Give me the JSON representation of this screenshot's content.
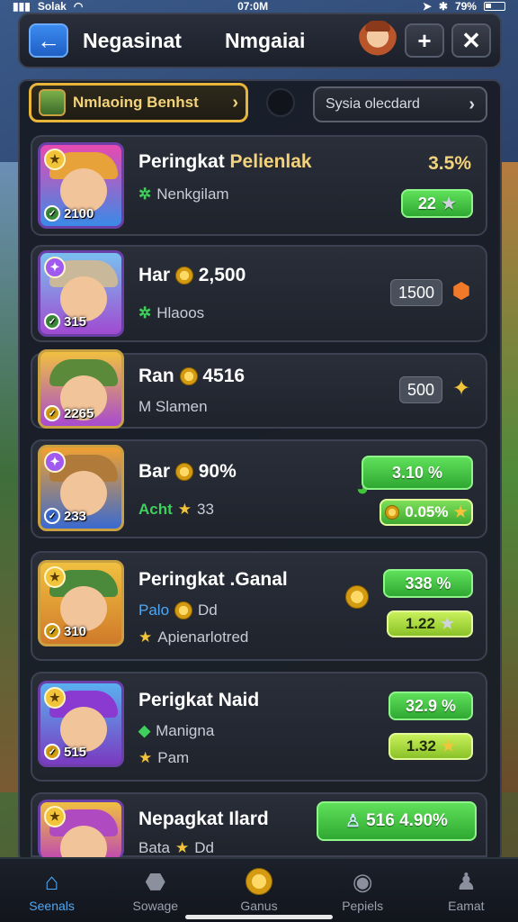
{
  "status": {
    "carrier": "Solak",
    "time": "07:0M",
    "battery": "79%"
  },
  "header": {
    "back_icon": "arrow-left-icon",
    "title": "Negasinat",
    "subtitle": "Nmgaiai",
    "plus_label": "+",
    "close_label": "✕"
  },
  "tabs": {
    "active_label": "Nmlaoing Benhst",
    "inactive_label": "Sysia olecdard"
  },
  "cards": [
    {
      "title": "Peringkat ",
      "title_accent": "Pelienlak",
      "sub": "Nenkgilam",
      "level": "2100",
      "pct": "3.5%",
      "pill": "22"
    },
    {
      "title": "Har",
      "title_value": "2,500",
      "sub": "Hlaoos",
      "level": "315",
      "pill": "1500"
    },
    {
      "title": "Ran",
      "title_value": "4516",
      "sub": "M Slamen",
      "level": "2265",
      "pill": "500"
    },
    {
      "title": "Bar",
      "title_value": "90%",
      "sub_label": "Acht",
      "sub": "33",
      "level": "233",
      "pill": "3.10 %",
      "pill2": "0.05%"
    },
    {
      "title": "Peringkat .Ganal",
      "sub_label": "Palo",
      "sub": "Dd",
      "sub2": "Apienarlotred",
      "level": "310",
      "pill": "338 %",
      "pill2": "1.22"
    },
    {
      "title": "Perigkat Naid",
      "sub": "Manigna",
      "sub2": "Pam",
      "level": "515",
      "pill": "32.9 %",
      "pill2": "1.32"
    },
    {
      "title": "Nepagkat Ilard",
      "sub_label": "Bata",
      "sub": "Dd",
      "pill": "516 4.90%"
    }
  ],
  "nav": [
    {
      "label": "Seenals",
      "icon": "home-icon"
    },
    {
      "label": "Sowage",
      "icon": "shield-icon"
    },
    {
      "label": "Ganus",
      "icon": "coin-icon"
    },
    {
      "label": "Pepiels",
      "icon": "camera-icon"
    },
    {
      "label": "Eamat",
      "icon": "person-icon"
    }
  ],
  "colors": {
    "accent_blue": "#3c8bf0",
    "accent_gold": "#e8b43a",
    "green": "#3fc43a"
  }
}
